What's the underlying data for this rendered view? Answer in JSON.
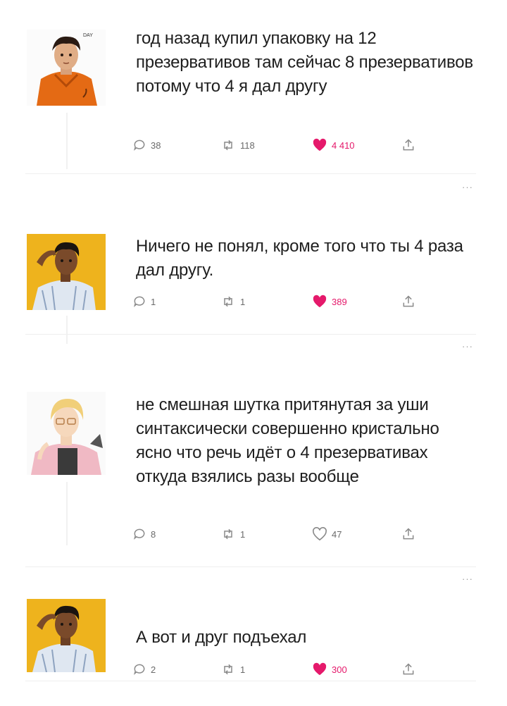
{
  "posts": [
    {
      "text": "год назад купил упаковку на 12 презервативов там сейчас 8 презервативов потому что 4 я дал другу",
      "avatar": "orange-hoodie-avatar",
      "replies": "38",
      "reposts": "118",
      "likes": "4 410",
      "liked": true
    },
    {
      "text": "Ничего не понял, кроме того что ты 4 раза дал другу.",
      "avatar": "yellow-bg-avatar",
      "replies": "1",
      "reposts": "1",
      "likes": "389",
      "liked": true
    },
    {
      "text": "не смешная шутка притянутая за уши синтаксически совершенно кристально ясно что речь идёт о 4 презервативах откуда взялись разы вообще",
      "avatar": "blond-glasses-avatar",
      "replies": "8",
      "reposts": "1",
      "likes": "47",
      "liked": false
    },
    {
      "text": "А вот и друг подъехал",
      "avatar": "yellow-bg-avatar",
      "replies": "2",
      "reposts": "1",
      "likes": "300",
      "liked": true
    }
  ],
  "more_label": "···",
  "colors": {
    "like": "#e5196b",
    "icon": "#8a8a8a",
    "text": "#1e1e1e"
  },
  "icons": [
    "reply-icon",
    "repost-icon",
    "like-icon",
    "share-icon",
    "more-icon"
  ]
}
